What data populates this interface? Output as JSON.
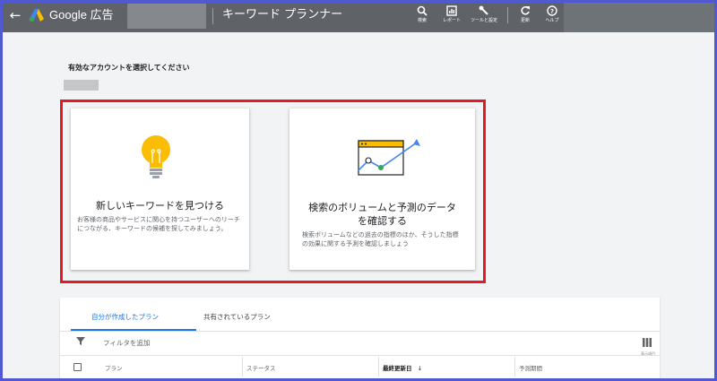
{
  "header": {
    "back_icon": "arrow-back-icon",
    "brand": "Google 広告",
    "page_title": "キーワード プランナー",
    "tools": [
      {
        "label": "検索",
        "icon": "search-icon"
      },
      {
        "label": "レポート",
        "icon": "report-icon"
      },
      {
        "label": "ツールと設定",
        "icon": "wrench-icon"
      },
      {
        "label": "更新",
        "icon": "refresh-icon"
      },
      {
        "label": "ヘルプ",
        "icon": "help-icon"
      }
    ]
  },
  "main": {
    "account_prompt": "有効なアカウントを選択してください",
    "cards": [
      {
        "title": "新しいキーワードを見つける",
        "description": "お客様の商品やサービスに関心を持つユーザーへのリーチにつながる、キーワードの候補を探してみましょう。",
        "icon": "lightbulb-icon"
      },
      {
        "title_line1": "検索のボリュームと予測のデータ",
        "title_line2": "を確認する",
        "description": "検索ボリュームなどの過去の指標のほか、そうした指標の効果に関する予測を確認しましょう",
        "icon": "trend-chart-icon"
      }
    ]
  },
  "plans": {
    "tabs": [
      "自分が作成したプラン",
      "共有されているプラン"
    ],
    "active_tab": 0,
    "filter_label": "フィルタを追加",
    "columns_label": "表示項目",
    "columns": [
      "プラン",
      "ステータス",
      "最終更新日",
      "予測期間"
    ]
  },
  "colors": {
    "topbar": "#5f6368",
    "accent_blue": "#1a73e8",
    "highlight_red": "#e21c26",
    "bulb_yellow": "#fbbc04",
    "frame_blue": "#5159d2"
  }
}
